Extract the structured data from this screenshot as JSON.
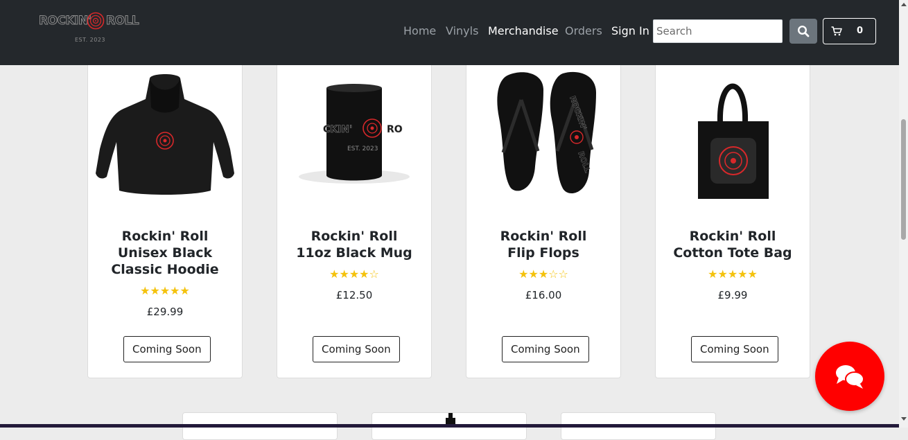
{
  "brand": {
    "logo_left": "ROCKIN'",
    "logo_right": "ROLL",
    "logo_est": "EST. 2023"
  },
  "nav": {
    "links": [
      {
        "label": "Home"
      },
      {
        "label": "Vinyls"
      },
      {
        "label": "Merchandise"
      },
      {
        "label": "Orders"
      },
      {
        "label": "Sign In"
      }
    ],
    "active": "Merchandise"
  },
  "search": {
    "placeholder": "Search",
    "value": "",
    "button_icon": "search-icon"
  },
  "cart": {
    "icon": "cart-icon",
    "count": "0"
  },
  "products": [
    {
      "title_lines": [
        "Rockin' Roll",
        "Unisex Black",
        "Classic Hoodie"
      ],
      "rating": 5,
      "rating_max": 5,
      "price": "£29.99",
      "button": "Coming Soon",
      "image": "hoodie"
    },
    {
      "title_lines": [
        "Rockin' Roll",
        "11oz Black Mug"
      ],
      "rating": 4,
      "rating_max": 5,
      "price": "£12.50",
      "button": "Coming Soon",
      "image": "mug"
    },
    {
      "title_lines": [
        "Rockin' Roll",
        "Flip Flops"
      ],
      "rating": 3,
      "rating_max": 5,
      "price": "£16.00",
      "button": "Coming Soon",
      "image": "flip-flops"
    },
    {
      "title_lines": [
        "Rockin' Roll",
        "Cotton Tote Bag"
      ],
      "rating": 5,
      "rating_max": 5,
      "price": "£9.99",
      "button": "Coming Soon",
      "image": "tote-bag"
    }
  ],
  "chat": {
    "icon": "chat-icon"
  },
  "colors": {
    "navbar_bg": "#24282c",
    "page_bg": "#ececec",
    "star": "#f4c20d",
    "chat_bg": "#ff0000",
    "brand_red": "#d8282a"
  }
}
